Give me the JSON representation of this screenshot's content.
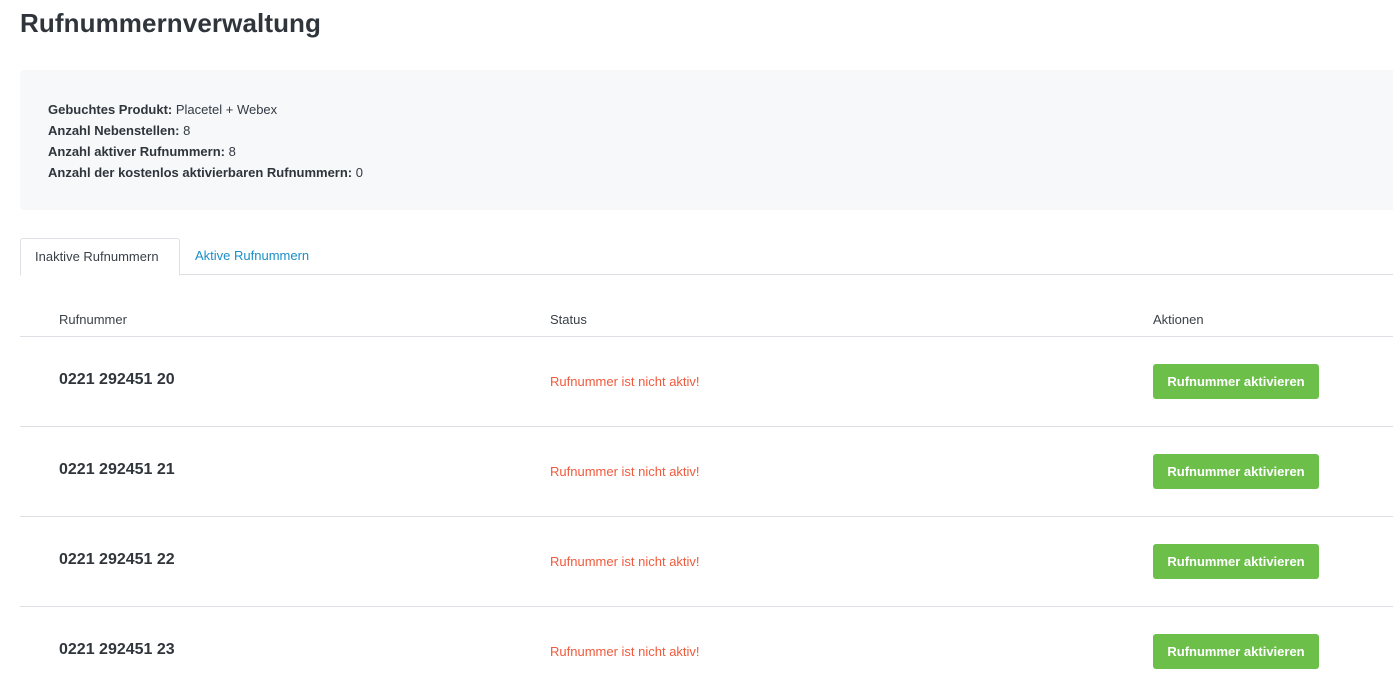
{
  "page": {
    "title": "Rufnummernverwaltung"
  },
  "info": {
    "product_label": "Gebuchtes Produkt:",
    "product_value": "Placetel + Webex",
    "extensions_label": "Anzahl Nebenstellen:",
    "extensions_value": "8",
    "active_numbers_label": "Anzahl aktiver Rufnummern:",
    "active_numbers_value": "8",
    "free_numbers_label": "Anzahl der kostenlos aktivierbaren Rufnummern:",
    "free_numbers_value": "0"
  },
  "tabs": [
    {
      "label": "Inaktive Rufnummern",
      "active": true
    },
    {
      "label": "Aktive Rufnummern",
      "active": false
    }
  ],
  "table": {
    "headers": {
      "number": "Rufnummer",
      "status": "Status",
      "actions": "Aktionen"
    },
    "rows": [
      {
        "number": "0221 292451 20",
        "status": "Rufnummer ist nicht aktiv!",
        "action": "Rufnummer aktivieren"
      },
      {
        "number": "0221 292451 21",
        "status": "Rufnummer ist nicht aktiv!",
        "action": "Rufnummer aktivieren"
      },
      {
        "number": "0221 292451 22",
        "status": "Rufnummer ist nicht aktiv!",
        "action": "Rufnummer aktivieren"
      },
      {
        "number": "0221 292451 23",
        "status": "Rufnummer ist nicht aktiv!",
        "action": "Rufnummer aktivieren"
      }
    ]
  },
  "colors": {
    "status_inactive": "#f05a3c",
    "button_primary": "#6cc04a",
    "tab_link": "#1a8fc7",
    "info_background": "#f6f8fa"
  }
}
